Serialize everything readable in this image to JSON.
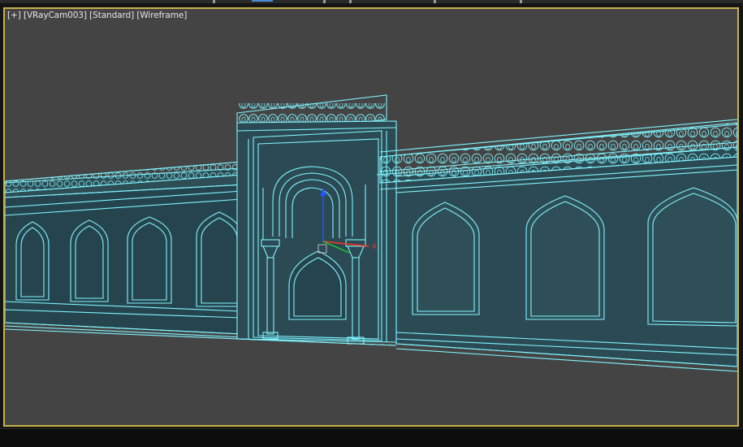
{
  "viewport": {
    "labels": {
      "menu": "[+]",
      "camera": "[VRayCam003]",
      "shading": "[Standard]",
      "mode": "[Wireframe]"
    },
    "active_border_color": "#c8b24a",
    "background_color": "#444444",
    "wire_color": "#7ff4ff"
  },
  "gizmo": {
    "z_axis_color": "#2255ff",
    "x_axis_color": "#ff3322",
    "y_axis_color": "#22cc33",
    "x_label": "X"
  }
}
